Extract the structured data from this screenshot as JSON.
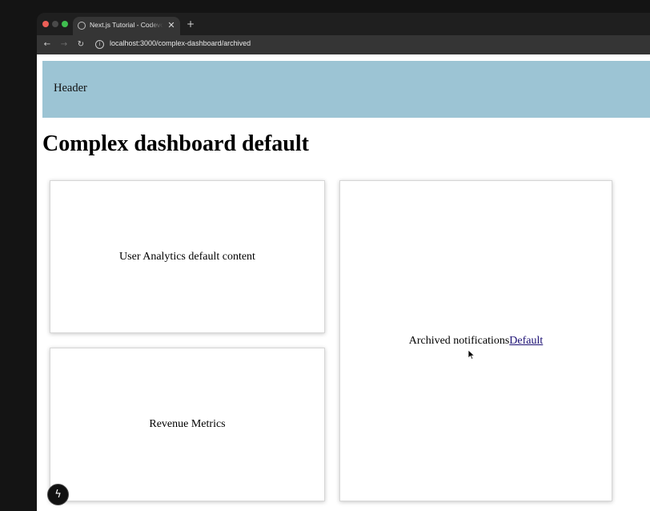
{
  "browser": {
    "tab": {
      "title": "Next.js Tutorial - Codevolution",
      "close_label": "✕"
    },
    "new_tab_label": "+",
    "toolbar": {
      "back_label": "←",
      "forward_label": "→",
      "reload_label": "↻",
      "site_info_label": "i",
      "url": "localhost:3000/complex-dashboard/archived"
    }
  },
  "page": {
    "header": {
      "text": "Header"
    },
    "title": "Complex dashboard default",
    "cards": {
      "users": {
        "text": "User Analytics default content"
      },
      "revenue": {
        "text": "Revenue Metrics"
      },
      "notifications": {
        "text": "Archived notifications",
        "link": "Default"
      }
    }
  },
  "dev_badge": {
    "icon": "lightning-bolt-icon",
    "label": "ϟ"
  },
  "colors": {
    "header_bg": "#9cc4d4",
    "browser_chrome": "#1f1f1f",
    "toolbar": "#353535",
    "link": "#1b0f73"
  }
}
